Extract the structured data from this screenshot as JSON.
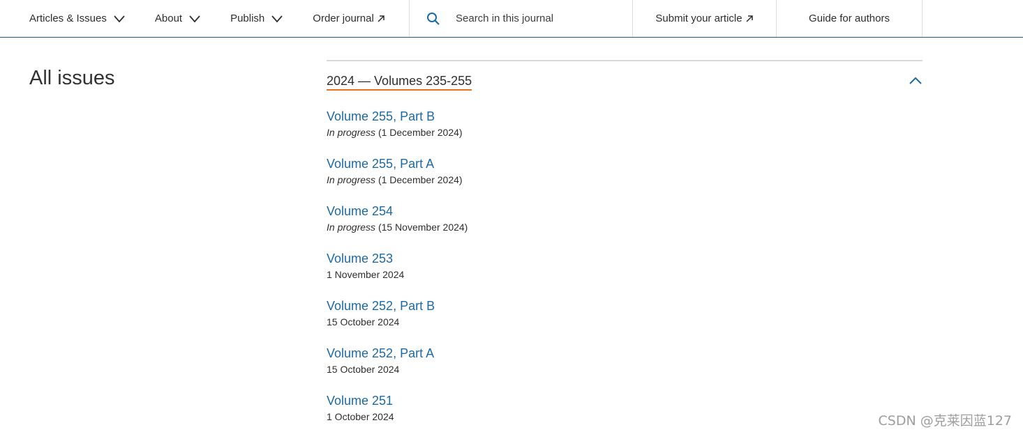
{
  "nav": {
    "articles_issues": "Articles & Issues",
    "about": "About",
    "publish": "Publish",
    "order_journal": "Order journal",
    "search_placeholder": "Search in this journal",
    "submit_article": "Submit your article",
    "guide_for_authors": "Guide for authors"
  },
  "page": {
    "title": "All issues"
  },
  "year_group": {
    "label": "2024 — Volumes 235-255",
    "expanded": true
  },
  "volumes": [
    {
      "title": "Volume 255, Part B",
      "status": "In progress",
      "date": "(1 December 2024)"
    },
    {
      "title": "Volume 255, Part A",
      "status": "In progress",
      "date": "(1 December 2024)"
    },
    {
      "title": "Volume 254",
      "status": "In progress",
      "date": "(15 November 2024)"
    },
    {
      "title": "Volume 253",
      "status": "",
      "date": "1 November 2024"
    },
    {
      "title": "Volume 252, Part B",
      "status": "",
      "date": "15 October 2024"
    },
    {
      "title": "Volume 252, Part A",
      "status": "",
      "date": "15 October 2024"
    },
    {
      "title": "Volume 251",
      "status": "",
      "date": "1 October 2024"
    }
  ],
  "watermark": "CSDN @克莱因蓝127",
  "colors": {
    "link": "#1b6aa5",
    "accent_underline": "#e9711c",
    "nav_border": "#1f5a86",
    "icon_blue": "#1b6aa5"
  }
}
